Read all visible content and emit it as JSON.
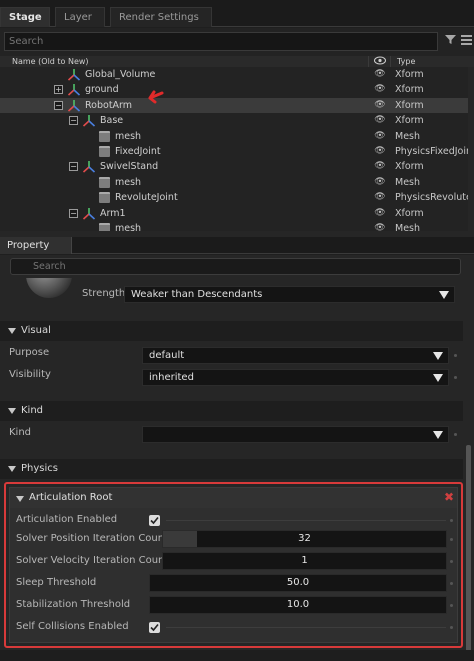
{
  "tabs": {
    "stage": "Stage",
    "layer": "Layer",
    "render_settings": "Render Settings"
  },
  "stage_search": {
    "placeholder": "Search"
  },
  "tree_header": {
    "name": "Name (Old to New)",
    "type": "Type"
  },
  "tree_rows": [
    {
      "name": "Global_Volume",
      "type": "Xform"
    },
    {
      "name": "ground",
      "type": "Xform"
    },
    {
      "name": "RobotArm",
      "type": "Xform"
    },
    {
      "name": "Base",
      "type": "Xform"
    },
    {
      "name": "mesh",
      "type": "Mesh"
    },
    {
      "name": "FixedJoint",
      "type": "PhysicsFixedJoint"
    },
    {
      "name": "SwivelStand",
      "type": "Xform"
    },
    {
      "name": "mesh",
      "type": "Mesh"
    },
    {
      "name": "RevoluteJoint",
      "type": "PhysicsRevolute"
    },
    {
      "name": "Arm1",
      "type": "Xform"
    },
    {
      "name": "mesh",
      "type": "Mesh"
    }
  ],
  "property": {
    "tab": "Property",
    "search_placeholder": "Search",
    "strength_label": "Strength",
    "strength_value": "Weaker than Descendants",
    "visual": {
      "title": "Visual",
      "purpose_label": "Purpose",
      "purpose_value": "default",
      "visibility_label": "Visibility",
      "visibility_value": "inherited"
    },
    "kind": {
      "title": "Kind",
      "kind_label": "Kind",
      "kind_value": ""
    },
    "physics": {
      "title": "Physics",
      "articulation_root": {
        "title": "Articulation Root",
        "articulation_enabled_label": "Articulation Enabled",
        "solver_position_label": "Solver Position Iteration Count",
        "solver_position_value": "32",
        "solver_velocity_label": "Solver Velocity Iteration Count",
        "solver_velocity_value": "1",
        "sleep_threshold_label": "Sleep Threshold",
        "sleep_threshold_value": "50.0",
        "stabilization_threshold_label": "Stabilization Threshold",
        "stabilization_threshold_value": "10.0",
        "self_collisions_label": "Self Collisions Enabled"
      }
    }
  },
  "colors": {
    "highlight_border": "#d83a3a",
    "arrow": "#e02a2a",
    "selected_row": "#3b3b3b"
  }
}
